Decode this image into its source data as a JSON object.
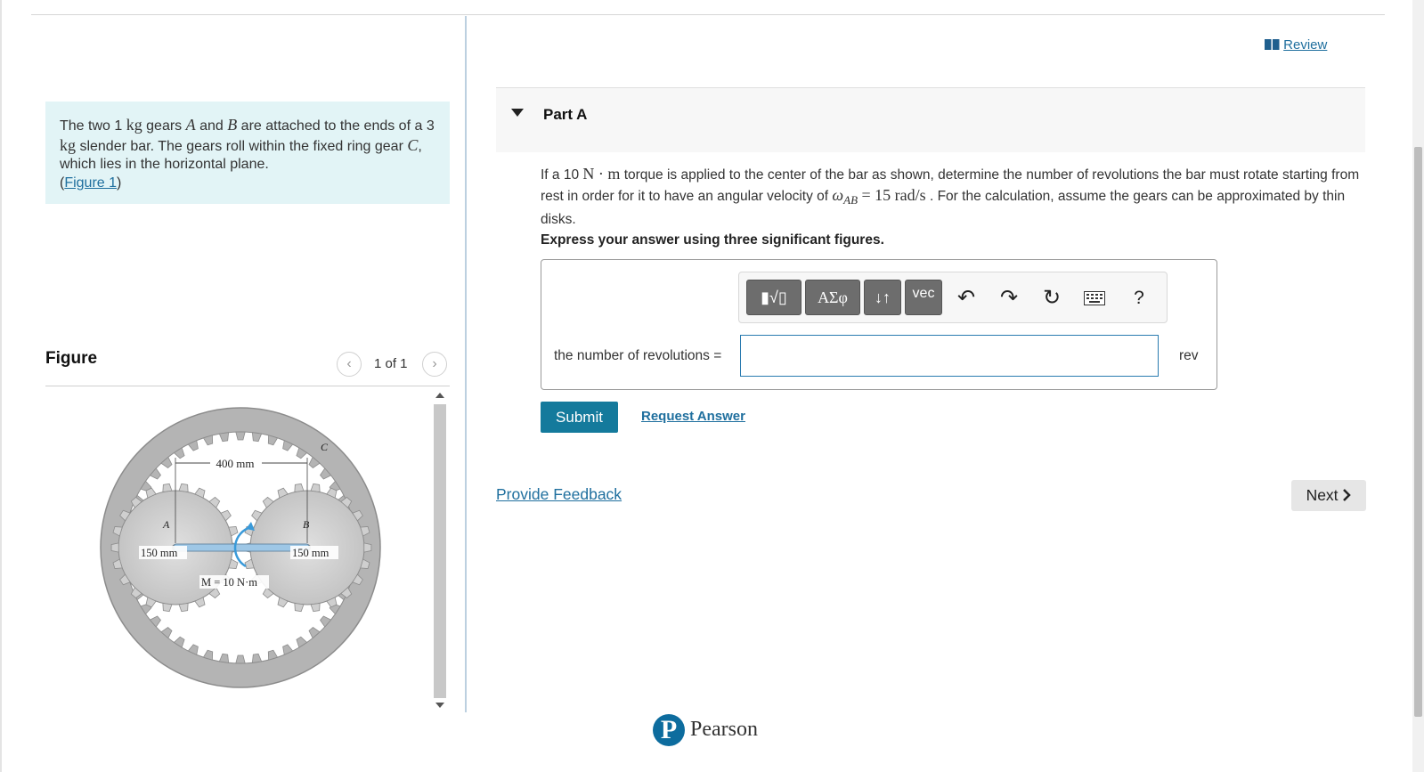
{
  "problem": {
    "text_1": "The two 1 ",
    "unit_kg_1": "kg",
    "text_2": " gears ",
    "gear_a": "A",
    "text_3": " and ",
    "gear_b": "B",
    "text_4": " are attached to the ends of a 3 ",
    "unit_kg_2": "kg",
    "text_5": " slender bar. The gears roll within the fixed ring gear ",
    "gear_c": "C",
    "text_6": ", which lies in the horizontal plane.",
    "figure_link": "Figure 1",
    "paren_open": "(",
    "paren_close": ")"
  },
  "figure": {
    "title": "Figure",
    "count": "1 of 1",
    "prev_icon": "chevron-left-icon",
    "next_icon": "chevron-right-icon",
    "labels": {
      "dim_top": "400 mm",
      "dim_left": "150 mm",
      "dim_right": "150 mm",
      "moment": "M = 10 N·m",
      "a": "A",
      "b": "B",
      "c": "C"
    }
  },
  "review": {
    "label": "Review",
    "icon": "book-icon"
  },
  "part": {
    "title": "Part A"
  },
  "question": {
    "t1": "If a 10 ",
    "u1": "N · m",
    "t2": " torque is applied to the center of the bar as shown, determine the number of revolutions the bar must rotate starting from rest in order for it to have an angular velocity of ",
    "omega": "ω",
    "omega_sub": "AB",
    "t3": " = 15 ",
    "u2": "rad/s",
    "t4": " . For the calculation, assume the gears can be approximated by thin disks."
  },
  "instruction": "Express your answer using three significant figures.",
  "toolbar": {
    "templates": "▮√▯",
    "greek": "ΑΣφ",
    "arrows": "↓↑",
    "vec": "vec",
    "undo_icon": "undo-icon",
    "redo_icon": "redo-icon",
    "reset_icon": "reset-icon",
    "keyboard_icon": "keyboard-icon",
    "help": "?"
  },
  "answer": {
    "label": "the number of revolutions =",
    "value": "",
    "unit": "rev"
  },
  "buttons": {
    "submit": "Submit",
    "request": "Request Answer",
    "feedback": "Provide Feedback",
    "next": "Next"
  },
  "footer": {
    "brand": "Pearson",
    "logo_letter": "P"
  }
}
